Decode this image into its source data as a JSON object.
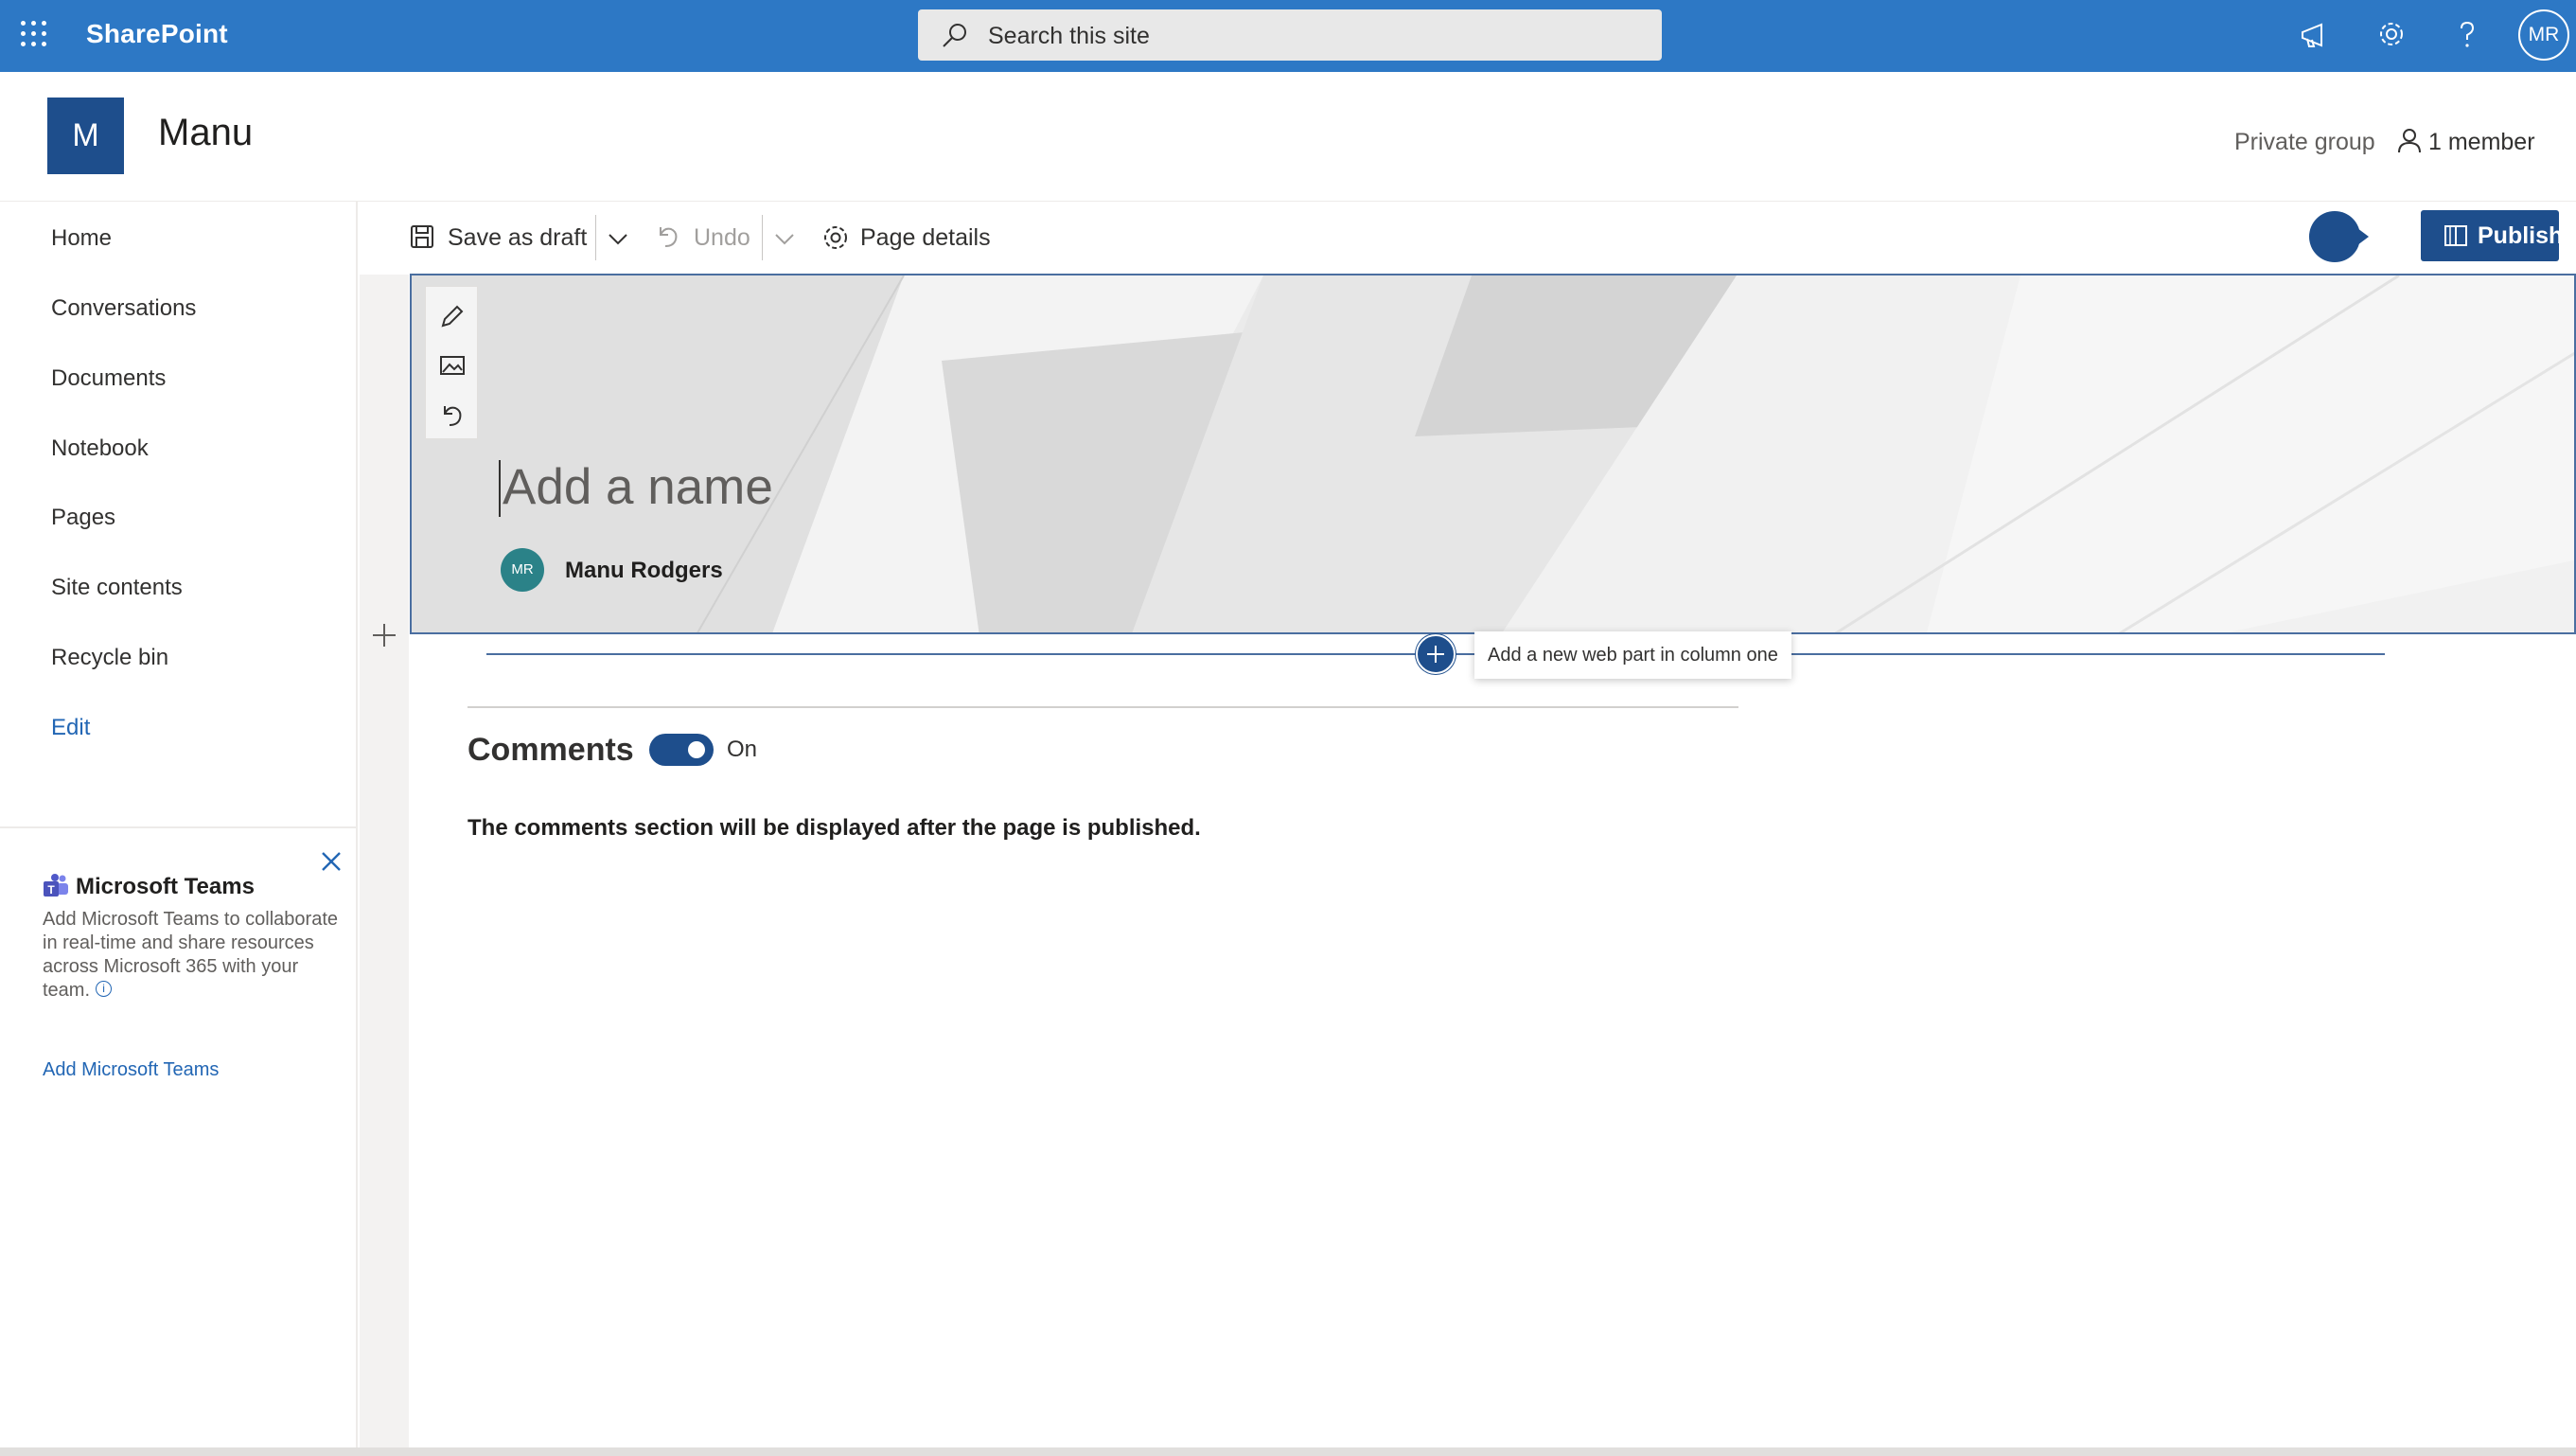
{
  "suite_bar": {
    "app_name": "SharePoint",
    "search_placeholder": "Search this site",
    "user_initials": "MR",
    "icons": [
      "app-launcher-icon",
      "megaphone-icon",
      "settings-icon",
      "help-icon"
    ]
  },
  "site": {
    "logo_letter": "M",
    "name": "Manu",
    "privacy": "Private group",
    "members": "1 member"
  },
  "nav": {
    "items": [
      "Home",
      "Conversations",
      "Documents",
      "Notebook",
      "Pages",
      "Site contents",
      "Recycle bin"
    ],
    "edit_label": "Edit"
  },
  "teams_card": {
    "title": "Microsoft Teams",
    "description": "Add Microsoft Teams to collaborate in real-time and share resources across Microsoft 365 with your team.",
    "link": "Add Microsoft Teams"
  },
  "command_bar": {
    "save_draft": "Save as draft",
    "undo": "Undo",
    "page_details": "Page details",
    "publish": "Publish"
  },
  "title_region": {
    "placeholder": "Add a name",
    "author_initials": "MR",
    "author_name": "Manu Rodgers"
  },
  "add_webpart": {
    "tooltip": "Add a new web part in column one"
  },
  "comments": {
    "title": "Comments",
    "toggle_state": "On",
    "note": "The comments section will be displayed after the page is published."
  },
  "colors": {
    "suite_bar": "#2d78c5",
    "accent": "#1e4e8c",
    "link": "#2266b4"
  }
}
